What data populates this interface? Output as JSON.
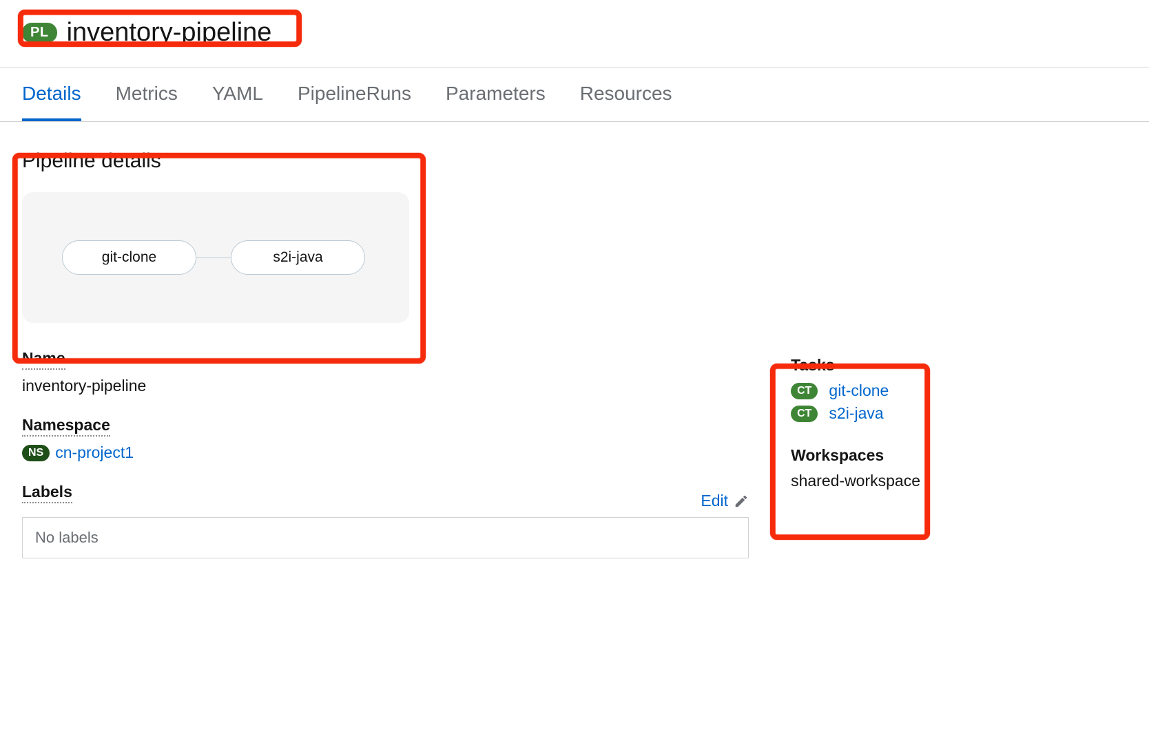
{
  "header": {
    "badge_text": "PL",
    "title": "inventory-pipeline"
  },
  "tabs": {
    "items": [
      {
        "label": "Details",
        "active": true
      },
      {
        "label": "Metrics",
        "active": false
      },
      {
        "label": "YAML",
        "active": false
      },
      {
        "label": "PipelineRuns",
        "active": false
      },
      {
        "label": "Parameters",
        "active": false
      },
      {
        "label": "Resources",
        "active": false
      }
    ]
  },
  "details": {
    "heading": "Pipeline details",
    "diagram_tasks": [
      "git-clone",
      "s2i-java"
    ],
    "name_label": "Name",
    "name_value": "inventory-pipeline",
    "namespace_label": "Namespace",
    "namespace_badge": "NS",
    "namespace_value": "cn-project1",
    "labels_label": "Labels",
    "labels_edit": "Edit",
    "labels_empty": "No labels"
  },
  "sidebar": {
    "tasks_label": "Tasks",
    "task_badge": "CT",
    "tasks": [
      "git-clone",
      "s2i-java"
    ],
    "workspaces_label": "Workspaces",
    "workspaces": [
      "shared-workspace"
    ]
  }
}
